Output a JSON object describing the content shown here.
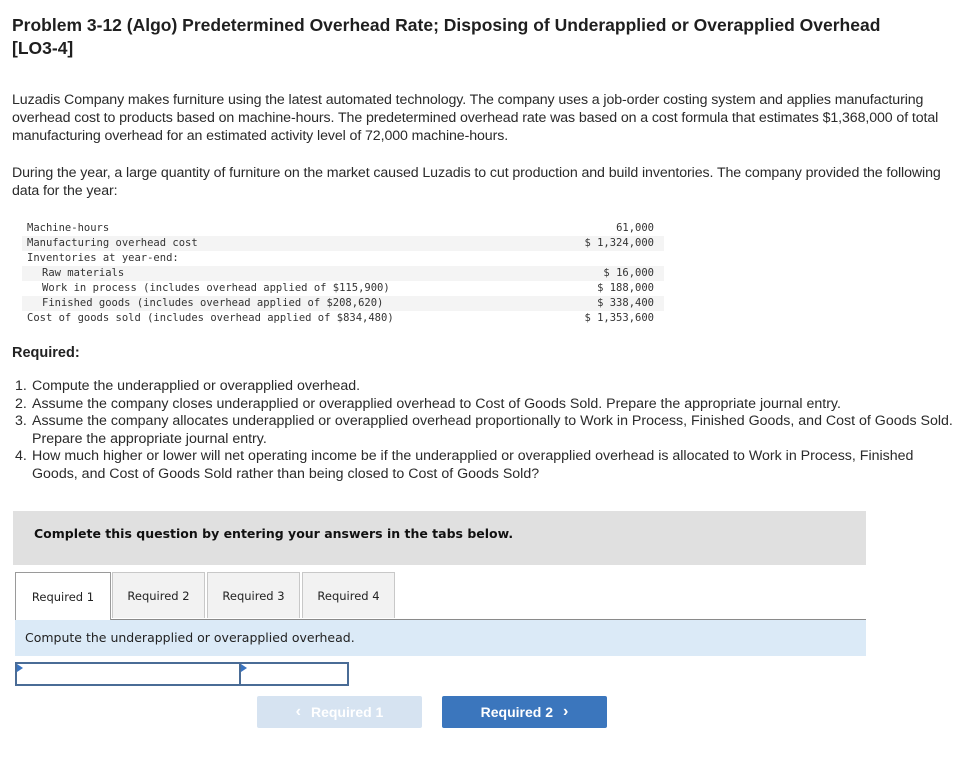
{
  "problem": {
    "title": "Problem 3-12 (Algo) Predetermined Overhead Rate; Disposing of Underapplied or Overapplied Overhead [LO3-4]",
    "intro": "Luzadis Company makes furniture using the latest automated technology. The company uses a job-order costing system and applies manufacturing overhead cost to products based on machine-hours. The predetermined overhead rate was based on a cost formula that estimates $1,368,000 of total manufacturing overhead for an estimated activity level of 72,000 machine-hours.",
    "context": "During the year, a large quantity of furniture on the market caused Luzadis to cut production and build inventories. The company provided the following data for the year:"
  },
  "data_table": {
    "rows": [
      {
        "label": "Machine-hours",
        "value": "61,000",
        "indent": false
      },
      {
        "label": "Manufacturing overhead cost",
        "value": "$ 1,324,000",
        "indent": false
      },
      {
        "label": "Inventories at year-end:",
        "value": "",
        "indent": false
      },
      {
        "label": "Raw materials",
        "value": "$ 16,000",
        "indent": true
      },
      {
        "label": "Work in process (includes overhead applied of $115,900)",
        "value": "$ 188,000",
        "indent": true
      },
      {
        "label": "Finished goods (includes overhead applied of $208,620)",
        "value": "$ 338,400",
        "indent": true
      },
      {
        "label": "Cost of goods sold (includes overhead applied of $834,480)",
        "value": "$ 1,353,600",
        "indent": false
      }
    ]
  },
  "required": {
    "heading": "Required:",
    "items": [
      {
        "num": "1.",
        "text": "Compute the underapplied or overapplied overhead."
      },
      {
        "num": "2.",
        "text": "Assume the company closes underapplied or overapplied overhead to Cost of Goods Sold. Prepare the appropriate journal entry."
      },
      {
        "num": "3.",
        "text": "Assume the company allocates underapplied or overapplied overhead proportionally to Work in Process, Finished Goods, and Cost of Goods Sold. Prepare the appropriate journal entry."
      },
      {
        "num": "4.",
        "text": "How much higher or lower will net operating income be if the underapplied or overapplied overhead is allocated to Work in Process, Finished Goods, and Cost of Goods Sold rather than being closed to Cost of Goods Sold?"
      }
    ]
  },
  "instructions": "Complete this question by entering your answers in the tabs below.",
  "tabs": [
    {
      "label": "Required 1",
      "active": true
    },
    {
      "label": "Required 2",
      "active": false
    },
    {
      "label": "Required 3",
      "active": false
    },
    {
      "label": "Required 4",
      "active": false
    }
  ],
  "tab_prompt": "Compute the underapplied or overapplied overhead.",
  "answer_inputs": [
    {
      "value": "",
      "placeholder": ""
    },
    {
      "value": "",
      "placeholder": ""
    }
  ],
  "navigation": {
    "prev_label": "Required 1",
    "next_label": "Required 2",
    "prev_icon": "‹",
    "next_icon": "›",
    "prev_disabled": true
  },
  "colors": {
    "instruction_band": "#e0e0e0",
    "prompt_band": "#dbeaf7",
    "next_button": "#3b76bd",
    "prev_button_disabled": "#d6e3f1",
    "input_border": "#4a6c96"
  }
}
